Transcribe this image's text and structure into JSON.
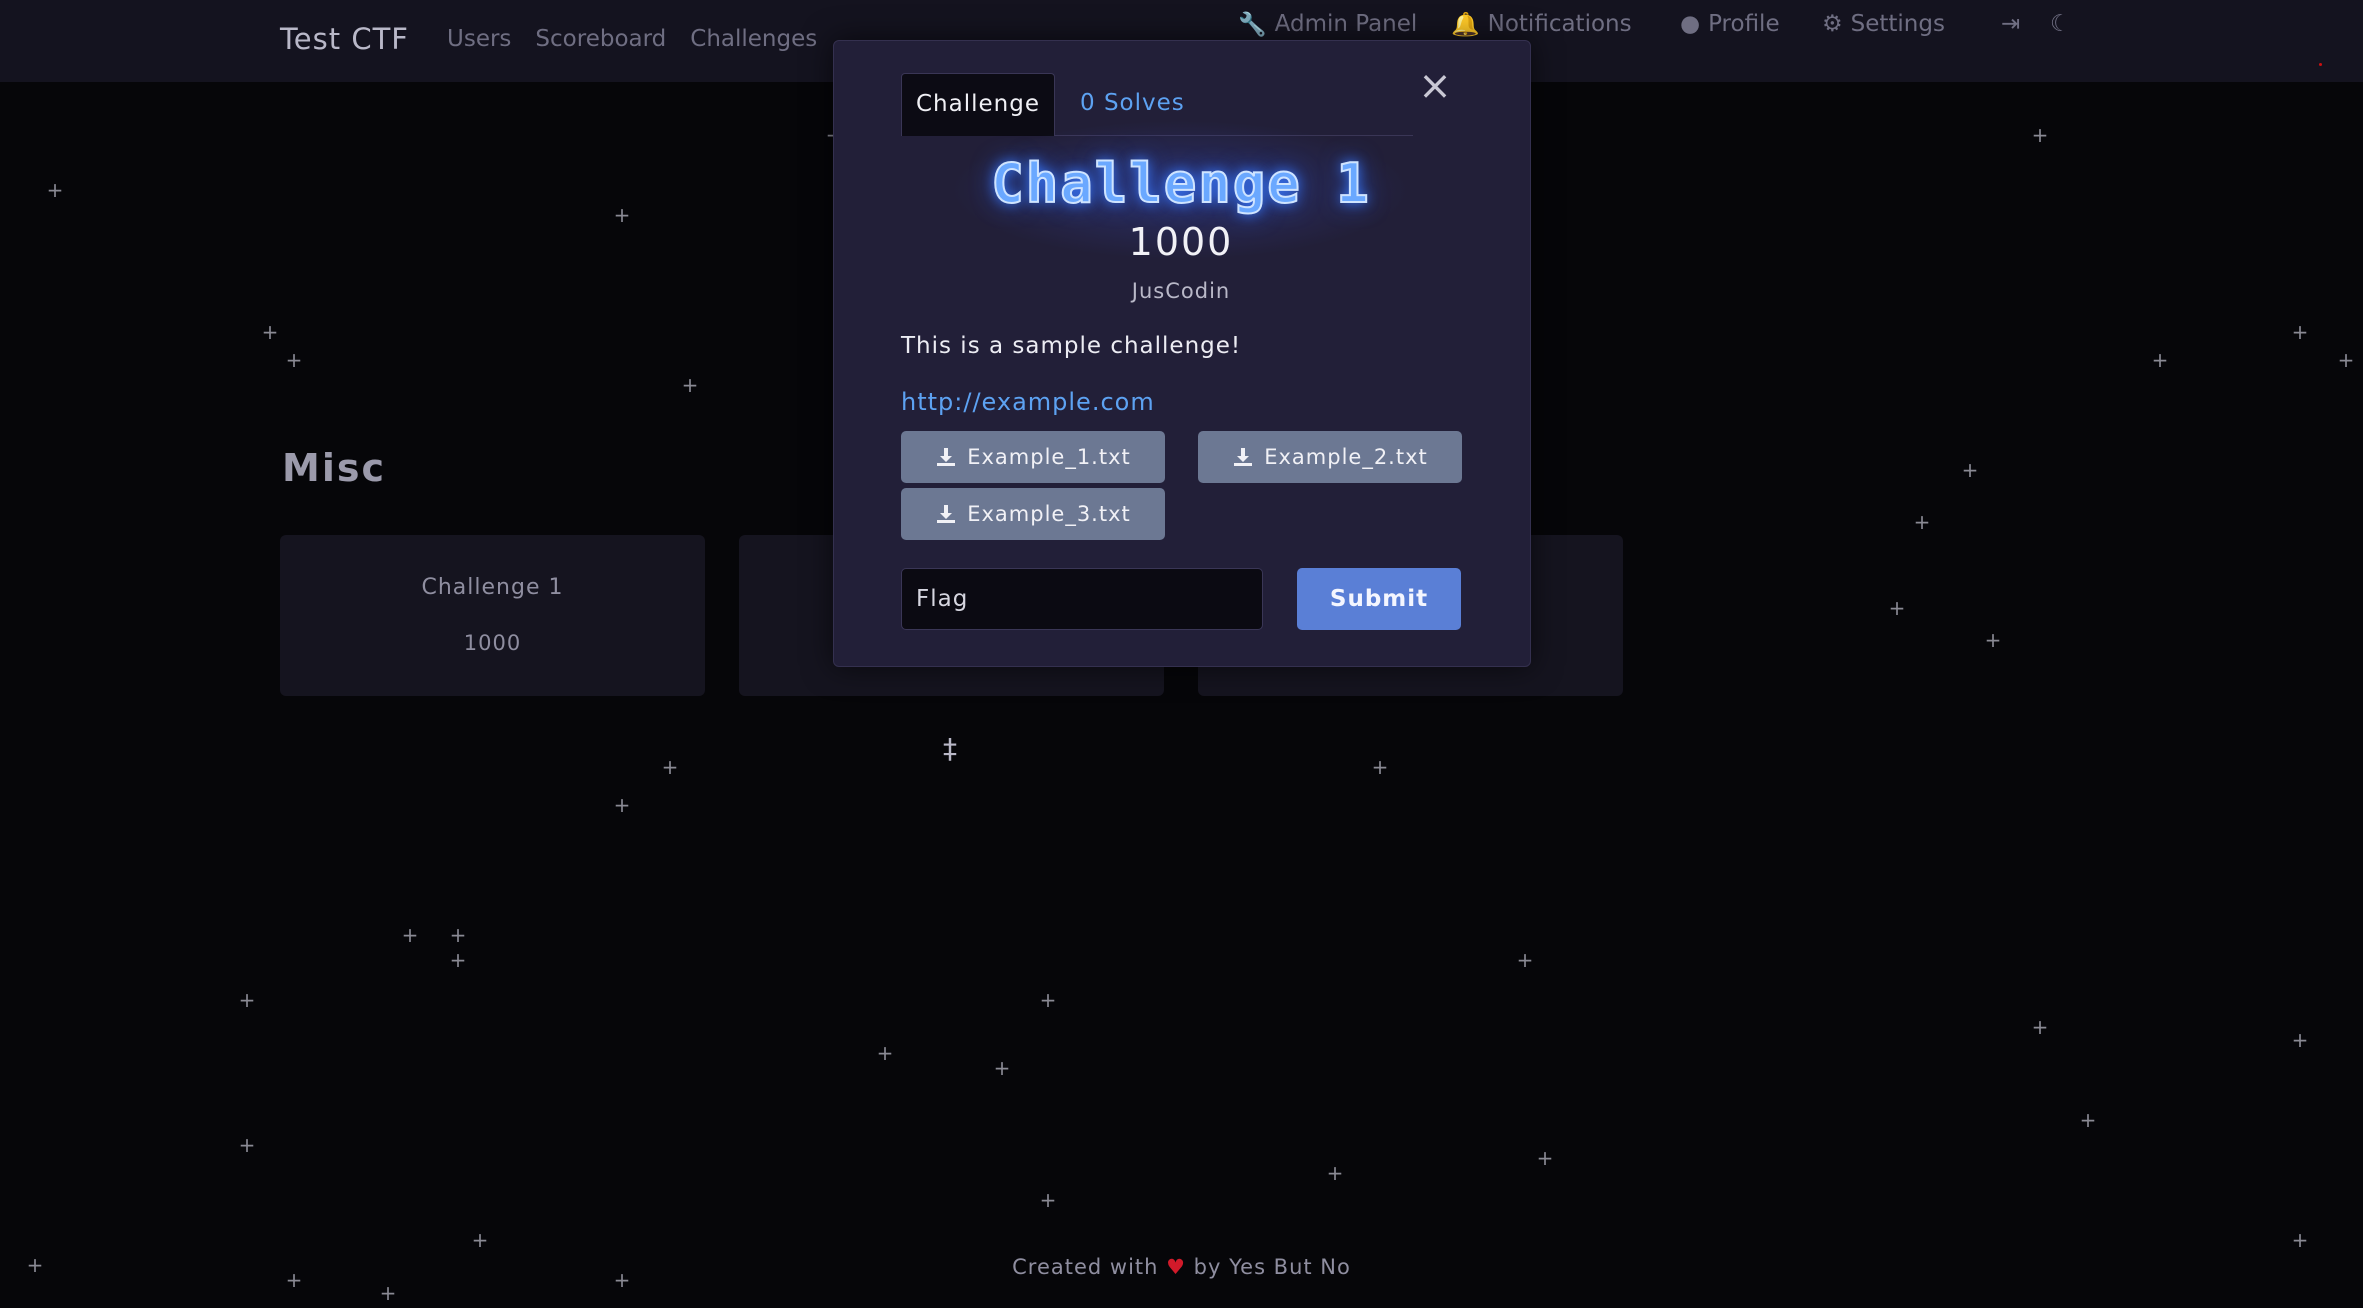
{
  "navbar": {
    "brand": "Test CTF",
    "links": [
      "Users",
      "Scoreboard",
      "Challenges"
    ],
    "right": {
      "admin": "Admin Panel",
      "notifications": "Notifications",
      "profile": "Profile",
      "settings": "Settings"
    }
  },
  "category": "Misc",
  "cards": [
    {
      "name": "Challenge 1",
      "value": "1000"
    },
    {
      "name": "",
      "value": ""
    },
    {
      "name": "",
      "value": ""
    }
  ],
  "modal": {
    "tab_challenge": "Challenge",
    "tab_solves": "0 Solves",
    "title": "Challenge 1",
    "value": "1000",
    "author": "JusCodin",
    "description": "This is a sample challenge!",
    "link": "http://example.com",
    "files": [
      "Example_1.txt",
      "Example_2.txt",
      "Example_3.txt"
    ],
    "flag_placeholder": "Flag",
    "submit": "Submit"
  },
  "footer": {
    "prefix": "Created with",
    "heart": "♥",
    "suffix": "by Yes But No"
  },
  "colors": {
    "background": "#060609",
    "navbar": "#14131f",
    "modal": "#221f38",
    "accent": "#5a7fd6",
    "link": "#5da2f2"
  }
}
